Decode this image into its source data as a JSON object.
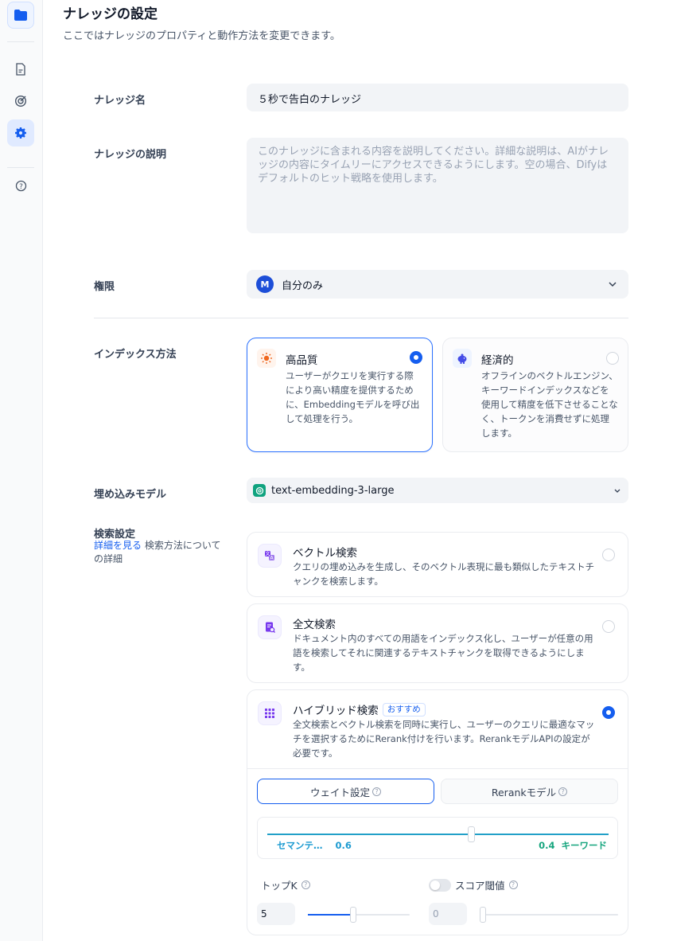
{
  "header": {
    "title": "ナレッジの設定",
    "subtitle": "ここではナレッジのプロパティと動作方法を変更できます。"
  },
  "sidebar": {
    "icons": [
      "folder-icon",
      "document-icon",
      "target-icon",
      "gear-icon",
      "help-icon"
    ]
  },
  "form": {
    "name_label": "ナレッジ名",
    "name_value": "５秒で告白のナレッジ",
    "desc_label": "ナレッジの説明",
    "desc_placeholder": "このナレッジに含まれる内容を説明してください。詳細な説明は、AIがナレッジの内容にタイムリーにアクセスできるようにします。空の場合、Difyはデフォルトのヒット戦略を使用します。",
    "permission_label": "権限",
    "permission_avatar": "M",
    "permission_value": "自分のみ",
    "index_label": "インデックス方法",
    "index_options": [
      {
        "title": "高品質",
        "desc": "ユーザーがクエリを実行する際により高い精度を提供するために、Embeddingモデルを呼び出して処理を行う。",
        "selected": true
      },
      {
        "title": "経済的",
        "desc": "オフラインのベクトルエンジン、キーワードインデックスなどを使用して精度を低下させることなく、トークンを消費せずに処理します。",
        "selected": false
      }
    ],
    "embedding_label": "埋め込みモデル",
    "embedding_value": "text-embedding-3-large",
    "search_label": "検索設定",
    "search_help_link": "詳細を見る",
    "search_help_text": " 検索方法についての詳細"
  },
  "search_methods": [
    {
      "title": "ベクトル検索",
      "desc": "クエリの埋め込みを生成し、そのベクトル表現に最も類似したテキストチャンクを検索します。",
      "selected": false
    },
    {
      "title": "全文検索",
      "desc": "ドキュメント内のすべての用語をインデックス化し、ユーザーが任意の用語を検索してそれに関連するテキストチャンクを取得できるようにします。",
      "selected": false
    },
    {
      "title": "ハイブリッド検索",
      "badge": "おすすめ",
      "desc": "全文検索とベクトル検索を同時に実行し、ユーザーのクエリに最適なマッチを選択するためにRerank付けを行います。RerankモデルAPIの設定が必要です。",
      "selected": true
    }
  ],
  "hybrid": {
    "tab_weight": "ウェイト設定",
    "tab_rerank": "Rerankモデル",
    "semantic_label": "セマンテ…",
    "semantic_value": "0.6",
    "keyword_value": "0.4",
    "keyword_label": "キーワード",
    "topk_label": "トップK",
    "topk_value": "5",
    "score_label": "スコア閾値",
    "score_value": "0"
  },
  "colors": {
    "accent": "#155eef",
    "semantic": "#1d9bd1",
    "keyword": "#16a57e"
  }
}
